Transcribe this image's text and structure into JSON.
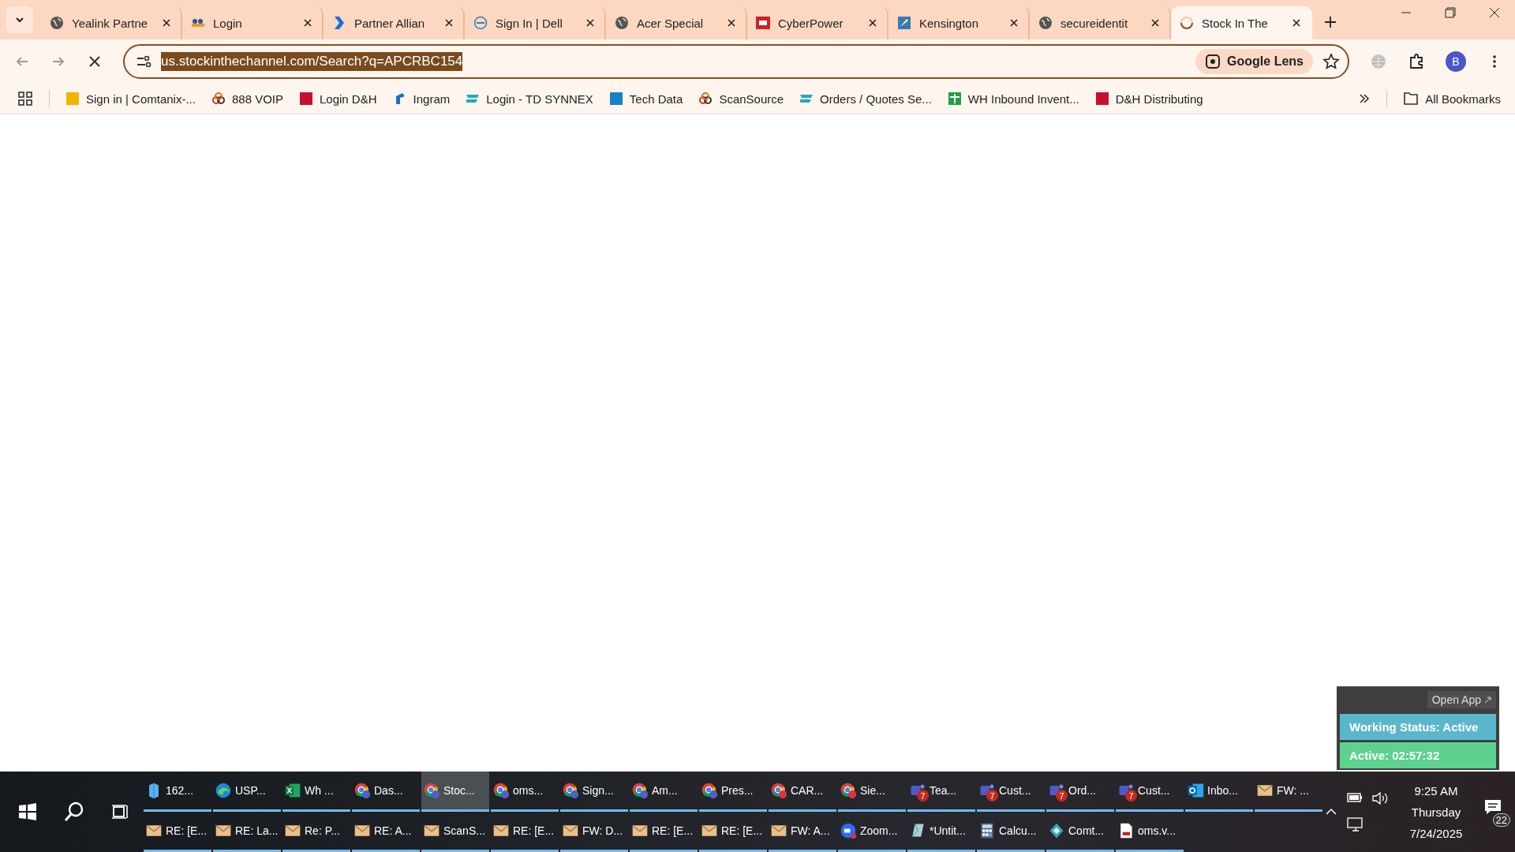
{
  "tabs": [
    {
      "title": "Yealink Partne",
      "selected": false
    },
    {
      "title": "Login",
      "selected": false
    },
    {
      "title": "Partner Allian",
      "selected": false
    },
    {
      "title": "Sign In | Dell",
      "selected": false
    },
    {
      "title": "Acer Special",
      "selected": false
    },
    {
      "title": "CyberPower",
      "selected": false
    },
    {
      "title": "Kensington",
      "selected": false
    },
    {
      "title": "secureidentit",
      "selected": false
    },
    {
      "title": "Stock In The",
      "selected": true
    }
  ],
  "address": {
    "url": "us.stockinthechannel.com/Search?q=APCRBC154",
    "selected": true,
    "lens_label": "Google Lens"
  },
  "profile": {
    "initial": "B"
  },
  "bookmarks": [
    {
      "label": "Sign in | Comtanix-..."
    },
    {
      "label": "888 VOIP"
    },
    {
      "label": "Login D&H"
    },
    {
      "label": "Ingram"
    },
    {
      "label": "Login - TD SYNNEX"
    },
    {
      "label": "Tech Data"
    },
    {
      "label": "ScanSource"
    },
    {
      "label": "Orders / Quotes Se..."
    },
    {
      "label": "WH Inbound Invent..."
    },
    {
      "label": "D&H Distributing"
    }
  ],
  "all_bookmarks": "All Bookmarks",
  "widget": {
    "open_app": "Open App",
    "status": "Working Status: Active",
    "timer": "Active: 02:57:32"
  },
  "taskbar_rows": [
    [
      {
        "label": "162...",
        "kind": "app",
        "selected": false
      },
      {
        "label": "USP...",
        "kind": "edge",
        "selected": false
      },
      {
        "label": "Wh ...",
        "kind": "excel",
        "selected": false
      },
      {
        "label": "Das...",
        "kind": "chrome",
        "selected": false
      },
      {
        "label": "Stoc...",
        "kind": "chrome",
        "selected": true
      },
      {
        "label": "oms...",
        "kind": "chrome",
        "selected": false
      },
      {
        "label": "Sign...",
        "kind": "chrome",
        "selected": false
      },
      {
        "label": "Am...",
        "kind": "chrome",
        "selected": false
      },
      {
        "label": "Pres...",
        "kind": "chrome",
        "selected": false
      },
      {
        "label": "CAR...",
        "kind": "chrome-red",
        "selected": false
      },
      {
        "label": "Sie...",
        "kind": "chrome-red",
        "selected": false
      },
      {
        "label": "Tea...",
        "kind": "teams",
        "badge": "7",
        "selected": false
      },
      {
        "label": "Cust...",
        "kind": "teams",
        "badge": "7",
        "selected": false
      },
      {
        "label": "Ord...",
        "kind": "teams",
        "badge": "7",
        "selected": false
      },
      {
        "label": "Cust...",
        "kind": "teams",
        "badge": "7",
        "selected": false
      },
      {
        "label": "Inbo...",
        "kind": "outlook",
        "selected": false
      },
      {
        "label": "FW: ...",
        "kind": "mail",
        "selected": false
      }
    ],
    [
      {
        "label": "RE: [E...",
        "kind": "mail",
        "selected": false
      },
      {
        "label": "RE: La...",
        "kind": "mail",
        "selected": false
      },
      {
        "label": "Re: P...",
        "kind": "mail",
        "selected": false
      },
      {
        "label": "RE: A...",
        "kind": "mail",
        "selected": false
      },
      {
        "label": "ScanS...",
        "kind": "mail",
        "selected": false
      },
      {
        "label": "RE: [E...",
        "kind": "mail",
        "selected": false
      },
      {
        "label": "FW: D...",
        "kind": "mail",
        "selected": false
      },
      {
        "label": "RE: [E...",
        "kind": "mail",
        "selected": false
      },
      {
        "label": "RE: [E...",
        "kind": "mail",
        "selected": false
      },
      {
        "label": "FW: A...",
        "kind": "mail",
        "selected": false
      },
      {
        "label": "Zoom...",
        "kind": "zoom",
        "selected": false
      },
      {
        "label": "*Untit...",
        "kind": "paint",
        "selected": false
      },
      {
        "label": "Calcu...",
        "kind": "calc",
        "selected": false
      },
      {
        "label": "Comt...",
        "kind": "comt",
        "selected": false
      },
      {
        "label": "oms.v...",
        "kind": "pdf",
        "selected": false
      }
    ]
  ],
  "tray": {
    "time": "9:25 AM",
    "day": "Thursday",
    "date": "7/24/2025",
    "notifications": "22"
  }
}
